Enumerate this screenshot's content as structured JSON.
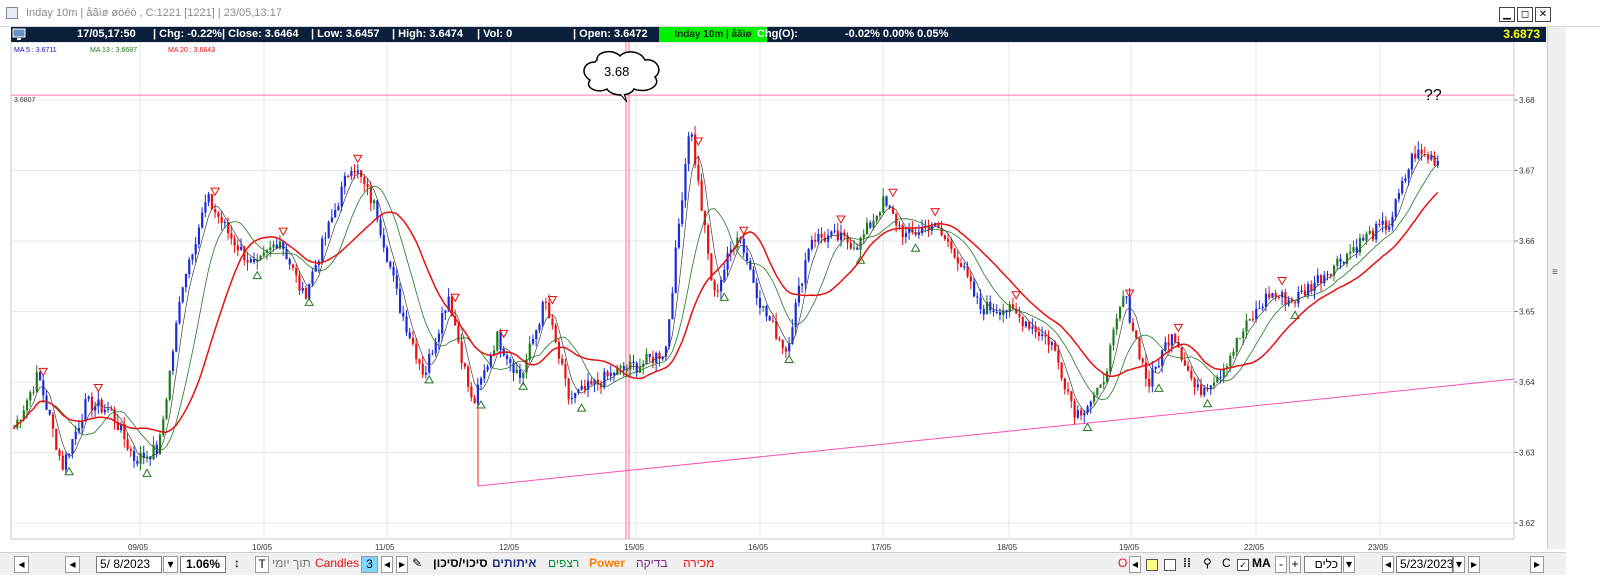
{
  "window": {
    "title": "Inday 10m | åãìø øöéò , C:1221  [1221]  | 23/05,13:17",
    "btn_minimize": "▁",
    "btn_restore": "◻",
    "btn_close": "✕"
  },
  "infobar": {
    "datetime": "17/05,17:50",
    "chg": "| Chg: -0.22%",
    "close": "| Close: 3.6464",
    "low": "| Low: 3.6457",
    "high": "| High: 3.6474",
    "vol": "| Vol: 0",
    "open": "| Open: 3.6472",
    "instrument": "Inday 10m | åãìø",
    "chg_open_label": "Chg(O):",
    "chg_open_values": "-0.02%  0.00%  0.05%",
    "last_price": "3.6873"
  },
  "legend": {
    "ma5": "MA 5 : 3.6711",
    "ma13": "MA 13 : 3.6687",
    "ma20": "MA 20 : 3.6643"
  },
  "annotations": {
    "horizontal_line_label": "3.6807",
    "bubble": "3.68",
    "question": "??"
  },
  "chart_data": {
    "type": "candlestick",
    "y_axis_ticks": [
      "3.68",
      "3.67",
      "3.66",
      "3.65",
      "3.64",
      "3.63",
      "3.62"
    ],
    "x_axis_ticks": [
      "09/05",
      "10/05",
      "11/05",
      "12/05",
      "15/05",
      "16/05",
      "17/05",
      "18/05",
      "19/05",
      "22/05",
      "23/05"
    ],
    "ylim": [
      3.62,
      3.6875
    ],
    "horizontal_line": 3.6807,
    "trendline": [
      [
        3.6255,
        3.6405
      ]
    ],
    "series": [
      {
        "name": "MA 5",
        "color": "#1f7a1f"
      },
      {
        "name": "MA 13",
        "color": "#404040"
      },
      {
        "name": "MA 20",
        "color": "#e81010"
      }
    ],
    "price_path": [
      3.6335,
      3.641,
      3.628,
      3.637,
      3.636,
      3.629,
      3.6305,
      3.6545,
      3.666,
      3.6605,
      3.656,
      3.6605,
      3.652,
      3.6615,
      3.6712,
      3.6645,
      3.6505,
      3.641,
      3.6525,
      3.6365,
      3.6465,
      3.6405,
      3.6515,
      3.6375,
      3.6395,
      3.6415,
      3.6425,
      3.6445,
      3.677,
      3.652,
      3.6615,
      3.6505,
      3.6445,
      3.6605,
      3.6605,
      3.6595,
      3.6655,
      3.6605,
      3.6625,
      3.6585,
      3.6505,
      3.6505,
      3.6485,
      3.6455,
      3.6355,
      3.6385,
      3.6525,
      3.6395,
      3.6475,
      3.6385,
      3.6415,
      3.6475,
      3.6525,
      3.6515,
      3.6545,
      3.6575,
      3.6605,
      3.6625,
      3.6725,
      3.6715
    ]
  },
  "bottombar": {
    "date_from": "5/  8/2023",
    "zoom": "1.06%",
    "t_label": "T",
    "intraday": "תוך יומי",
    "candles": "Candles",
    "candles_count": "3",
    "pen": "✎",
    "risk_tab": "סיכוי/סיכון",
    "signals_tab": "איתותים",
    "floors_tab": "רצפים",
    "power_tab": "Power",
    "check_tab": "בדיקה",
    "sell_tab": "מכירה",
    "o_label": "O",
    "c_label": "C",
    "ma_label": "MA",
    "minus": "-",
    "plus": "+",
    "tools_select": "כלים",
    "date_to": "5/23/2023"
  }
}
